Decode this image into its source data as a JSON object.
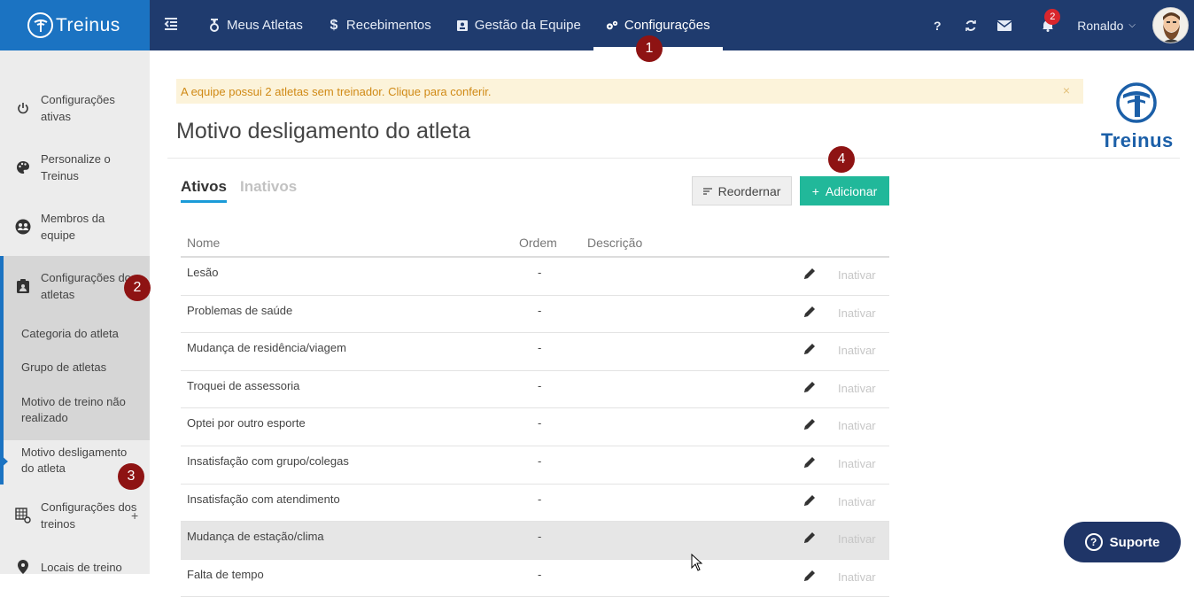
{
  "brand": {
    "name": "Treinus"
  },
  "nav": {
    "items": [
      {
        "label": "Meus Atletas",
        "icon": "medal-icon"
      },
      {
        "label": "Recebimentos",
        "icon": "dollar-icon"
      },
      {
        "label": "Gestão da Equipe",
        "icon": "id-card-icon"
      },
      {
        "label": "Configurações",
        "icon": "gears-icon",
        "active": true
      }
    ]
  },
  "header": {
    "help_label": "?",
    "notifications_count": "2",
    "user_name": "Ronaldo"
  },
  "steps": [
    "1",
    "2",
    "3",
    "4"
  ],
  "sidebar": {
    "items": [
      {
        "label": "Configurações ativas",
        "icon": "power-icon"
      },
      {
        "label": "Personalize o Treinus",
        "icon": "palette-icon"
      },
      {
        "label": "Membros da equipe",
        "icon": "team-icon"
      },
      {
        "label": "Configurações dos atletas",
        "icon": "badge-icon"
      },
      {
        "label": "Configurações dos treinos",
        "icon": "grid-settings-icon"
      },
      {
        "label": "Locais de treino",
        "icon": "location-icon"
      }
    ],
    "sub_items": [
      {
        "label": "Categoria do atleta"
      },
      {
        "label": "Grupo de atletas"
      },
      {
        "label": "Motivo de treino não realizado"
      },
      {
        "label": "Motivo desligamento do atleta",
        "active": true
      }
    ],
    "expand_label": "+"
  },
  "alert": {
    "text": "A equipe possui 2 atletas sem treinador. Clique para conferir.",
    "close": "×"
  },
  "page": {
    "title": "Motivo desligamento do atleta",
    "logo_text": "Treinus"
  },
  "tabs": [
    {
      "label": "Ativos",
      "active": true
    },
    {
      "label": "Inativos",
      "active": false
    }
  ],
  "actions": {
    "reorder_label": "Reordernar",
    "add_label": "Adicionar"
  },
  "table": {
    "headers": {
      "name": "Nome",
      "order": "Ordem",
      "description": "Descrição"
    },
    "action_label": "Inativar",
    "rows": [
      {
        "name": "Lesão",
        "order": "-",
        "description": ""
      },
      {
        "name": "Problemas de saúde",
        "order": "-",
        "description": ""
      },
      {
        "name": "Mudança de residência/viagem",
        "order": "-",
        "description": ""
      },
      {
        "name": "Troquei de assessoria",
        "order": "-",
        "description": ""
      },
      {
        "name": "Optei por outro esporte",
        "order": "-",
        "description": ""
      },
      {
        "name": "Insatisfação com grupo/colegas",
        "order": "-",
        "description": ""
      },
      {
        "name": "Insatisfação com atendimento",
        "order": "-",
        "description": ""
      },
      {
        "name": "Mudança de estação/clima",
        "order": "-",
        "description": ""
      },
      {
        "name": "Falta de tempo",
        "order": "-",
        "description": ""
      }
    ]
  },
  "support": {
    "label": "Suporte"
  },
  "colors": {
    "topbar": "#1f3b6e",
    "brand": "#1b73c2",
    "accent_green": "#21b89a",
    "alert_bg": "#fcf3da",
    "step_marker": "#8e1313"
  }
}
